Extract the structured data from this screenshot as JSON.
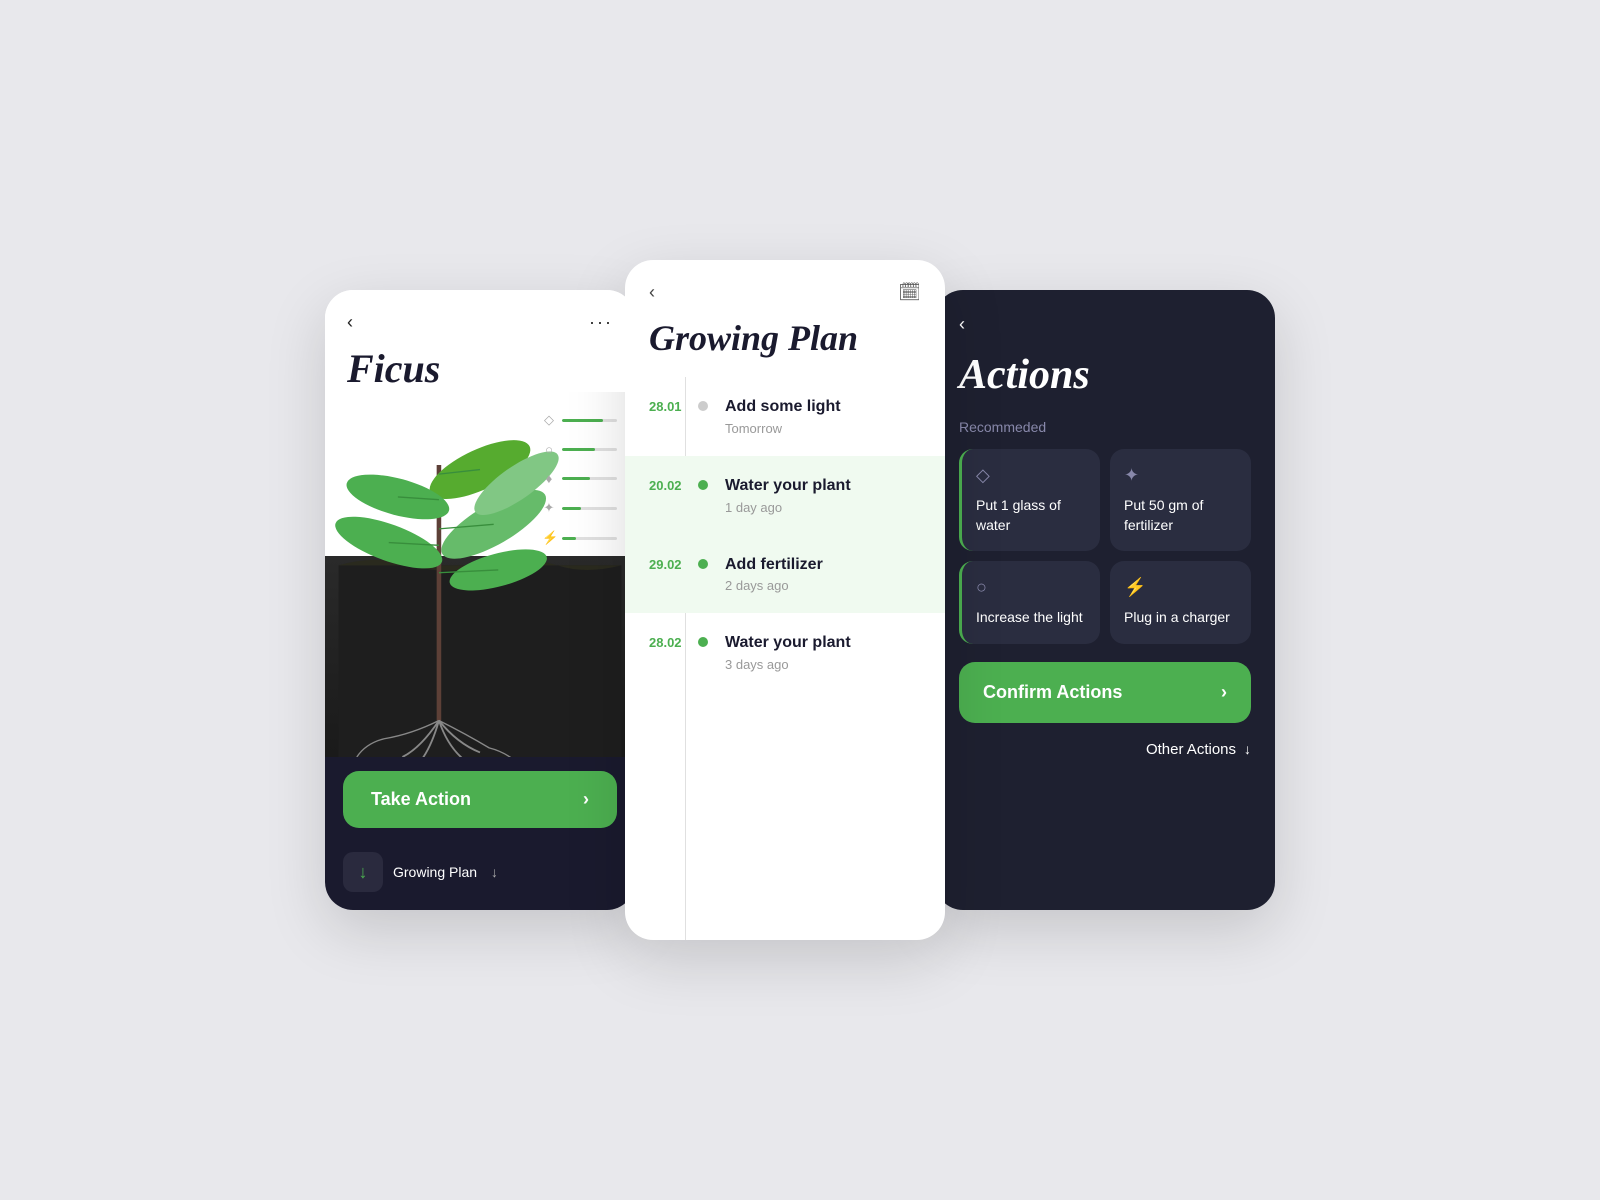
{
  "screen1": {
    "back_label": "‹",
    "menu_label": "···",
    "title": "Ficus",
    "metrics": [
      {
        "icon": "💧",
        "fill": 75
      },
      {
        "icon": "☀",
        "fill": 60
      },
      {
        "icon": "🌡",
        "fill": 50
      },
      {
        "icon": "🌿",
        "fill": 40
      },
      {
        "icon": "⚡",
        "fill": 30
      }
    ],
    "take_action_label": "Take Action",
    "take_action_arrow": "›",
    "growing_plan_label": "Growing Plan",
    "growing_plan_arrow": "↓"
  },
  "screen2": {
    "back_label": "‹",
    "calendar_icon": "📅",
    "title": "Growing Plan",
    "timeline": [
      {
        "date": "28.01",
        "title": "Add some light",
        "subtitle": "Tomorrow",
        "highlighted": false,
        "dot": "grey"
      },
      {
        "date": "20.02",
        "title": "Water your plant",
        "subtitle": "1 day ago",
        "highlighted": true,
        "dot": "green"
      },
      {
        "date": "29.02",
        "title": "Add fertilizer",
        "subtitle": "2 days ago",
        "highlighted": true,
        "dot": "green"
      },
      {
        "date": "28.02",
        "title": "Water your plant",
        "subtitle": "3 days ago",
        "highlighted": false,
        "dot": "green"
      }
    ]
  },
  "screen3": {
    "back_label": "‹",
    "title": "Actions",
    "recommended_label": "Recommeded",
    "cards": [
      {
        "icon": "💧",
        "text": "Put 1 glass of water",
        "selected": true
      },
      {
        "icon": "🌿",
        "text": "Put 50 gm of fertilizer",
        "selected": false
      },
      {
        "icon": "☀",
        "text": "Increase the light",
        "selected": true
      },
      {
        "icon": "⚡",
        "text": "Plug in a charger",
        "selected": false
      }
    ],
    "confirm_label": "Confirm Actions",
    "confirm_arrow": "›",
    "other_actions_label": "Other Actions",
    "other_actions_icon": "↓"
  }
}
